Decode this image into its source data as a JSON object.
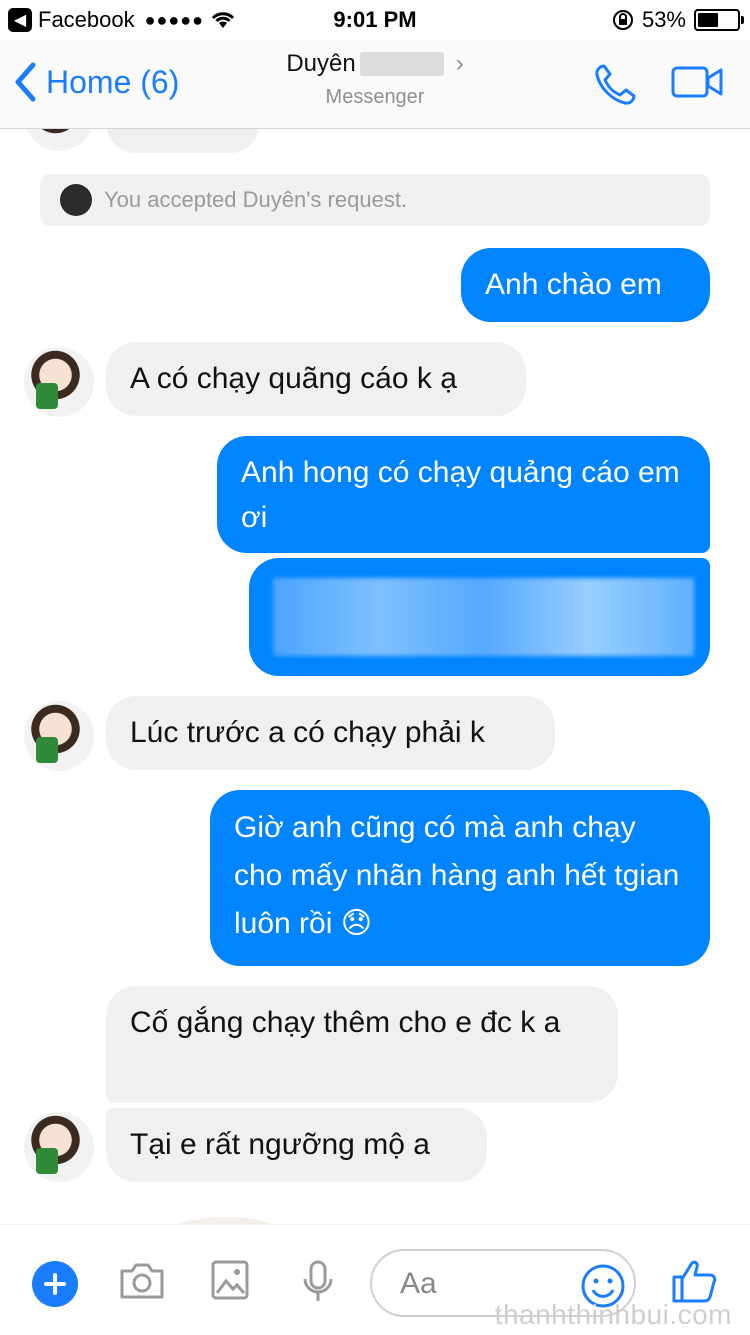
{
  "status_bar": {
    "app_back": "Facebook",
    "signal": "●●●●●",
    "time": "9:01 PM",
    "battery": "53%",
    "battery_level": 0.53
  },
  "nav": {
    "back_label": "Home (6)",
    "contact_name": "Duyên",
    "subtitle": "Messenger"
  },
  "chat": {
    "notice": "You accepted Duyên's request.",
    "messages": [
      {
        "from": "me",
        "text": "Anh chào em"
      },
      {
        "from": "them",
        "text": "A có chạy quãng cáo k ạ"
      },
      {
        "from": "me",
        "text": "Anh hong có chạy quảng cáo em ơi"
      },
      {
        "from": "me",
        "text": ""
      },
      {
        "from": "them",
        "text": "Lúc trước a có chạy phải k"
      },
      {
        "from": "me",
        "text": "Giờ anh cũng có mà anh chạy cho mấy nhãn hàng anh hết tgian luôn rồi 😞"
      },
      {
        "from": "them",
        "text": "Cố gắng chạy thêm cho e đc k a"
      },
      {
        "from": "them",
        "text": "Tại e rất ngưỡng mộ a"
      }
    ]
  },
  "composer": {
    "placeholder": "Aa"
  },
  "watermark": "thanhthinhbui.com",
  "colors": {
    "accent": "#1a7dfb",
    "my_bubble": "#0084ff",
    "their_bubble": "#f1f0f0"
  }
}
